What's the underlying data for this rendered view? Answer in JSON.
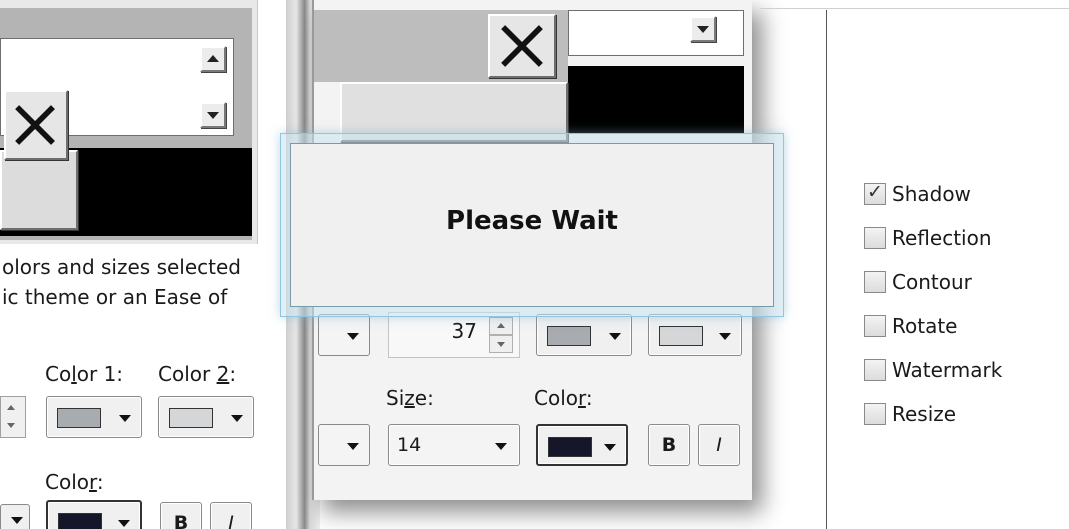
{
  "left_panel": {
    "description_line1": "olors and sizes selected",
    "description_line2": "ic theme or an Ease of",
    "color1_label_pre": "Co",
    "color1_label_key": "l",
    "color1_label_post": "or 1:",
    "color2_label_pre": "Color ",
    "color2_label_key": "2",
    "color2_label_post": ":",
    "color1_swatch": "#a8abb0",
    "color2_swatch": "#d4d6d8",
    "font_color_label_pre": "Colo",
    "font_color_label_key": "r",
    "font_color_label_post": ":",
    "font_color_swatch": "#16162a",
    "bold_label": "B",
    "italic_label": "I"
  },
  "middle_panel": {
    "number_value": "37",
    "color1_swatch": "#a8abb0",
    "color2_swatch": "#d4d6d8",
    "size_label_pre": "Si",
    "size_label_key": "z",
    "size_label_post": "e:",
    "size_value": "14",
    "color_label_pre": "Colo",
    "color_label_key": "r",
    "color_label_post": ":",
    "font_color_swatch": "#16162a",
    "bold_label": "B",
    "italic_label": "I"
  },
  "effects": {
    "options": [
      {
        "label": "Shadow",
        "checked": true
      },
      {
        "label": "Reflection",
        "checked": false
      },
      {
        "label": "Contour",
        "checked": false
      },
      {
        "label": "Rotate",
        "checked": false
      },
      {
        "label": "Watermark",
        "checked": false
      },
      {
        "label": "Resize",
        "checked": false
      }
    ]
  },
  "dialog": {
    "message": "Please Wait"
  },
  "colors": {
    "dialog_border": "#8fc5dd",
    "preview_black": "#000000",
    "preview_gray": "#b0b0b0"
  }
}
